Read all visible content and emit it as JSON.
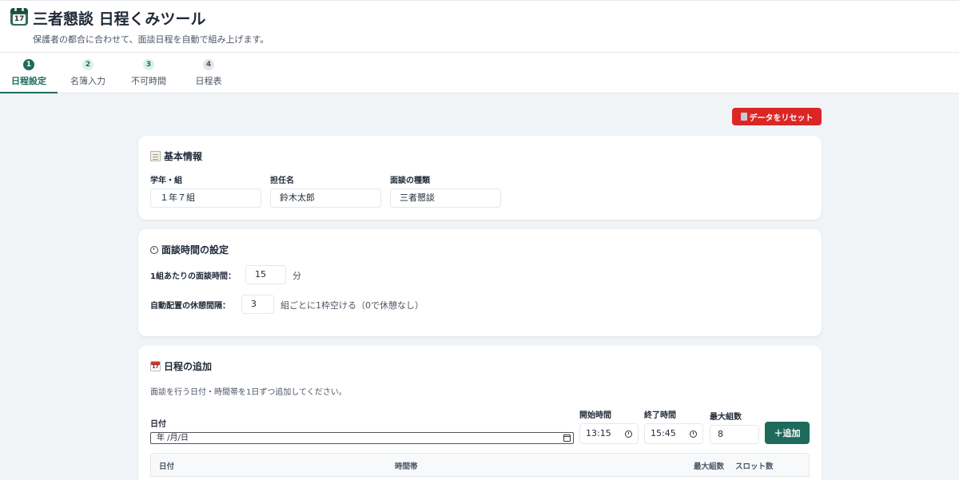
{
  "app": {
    "title": "三者懇談 日程くみツール",
    "subtitle": "保護者の都合に合わせて、面談日程を自動で組み上げます。",
    "icon": "calendar-icon",
    "icon_day": "17"
  },
  "tabs": [
    {
      "num": "1",
      "label": "日程設定",
      "active": true
    },
    {
      "num": "2",
      "label": "名簿入力",
      "active": false
    },
    {
      "num": "3",
      "label": "不可時間",
      "active": false
    },
    {
      "num": "4",
      "label": "日程表",
      "active": false
    }
  ],
  "reset_button": {
    "label": "データをリセット",
    "icon": "trash-icon"
  },
  "basic_info": {
    "title": "基本情報",
    "icon": "memo-icon",
    "fields": [
      {
        "label": "学年・組",
        "value": "１年７組"
      },
      {
        "label": "担任名",
        "value": "鈴木太郎"
      },
      {
        "label": "面談の種類",
        "value": "三者懇談"
      }
    ]
  },
  "time_settings": {
    "title": "面談時間の設定",
    "icon": "clock-icon",
    "duration_label": "1組あたりの面談時間：",
    "duration_value": "15",
    "duration_unit": "分",
    "break_label": "自動配置の休憩間隔：",
    "break_value": "3",
    "break_note": "組ごとに1枠空ける（0で休憩なし）"
  },
  "schedule_add": {
    "title": "日程の追加",
    "icon": "calendar-icon",
    "description": "面談を行う日付・時間帯を1日ずつ追加してください。",
    "date_label": "日付",
    "date_placeholder": "年 /月/日",
    "start_label": "開始時間",
    "start_value": "13:15",
    "end_label": "終了時間",
    "end_value": "15:45",
    "max_label": "最大組数",
    "max_value": "8",
    "add_button": "＋追加"
  },
  "table": {
    "columns": [
      "日付",
      "時間帯",
      "最大組数",
      "スロット数"
    ]
  },
  "colors": {
    "accent": "#1e6b5c",
    "danger": "#dc2626",
    "background": "#f1f4f7"
  }
}
